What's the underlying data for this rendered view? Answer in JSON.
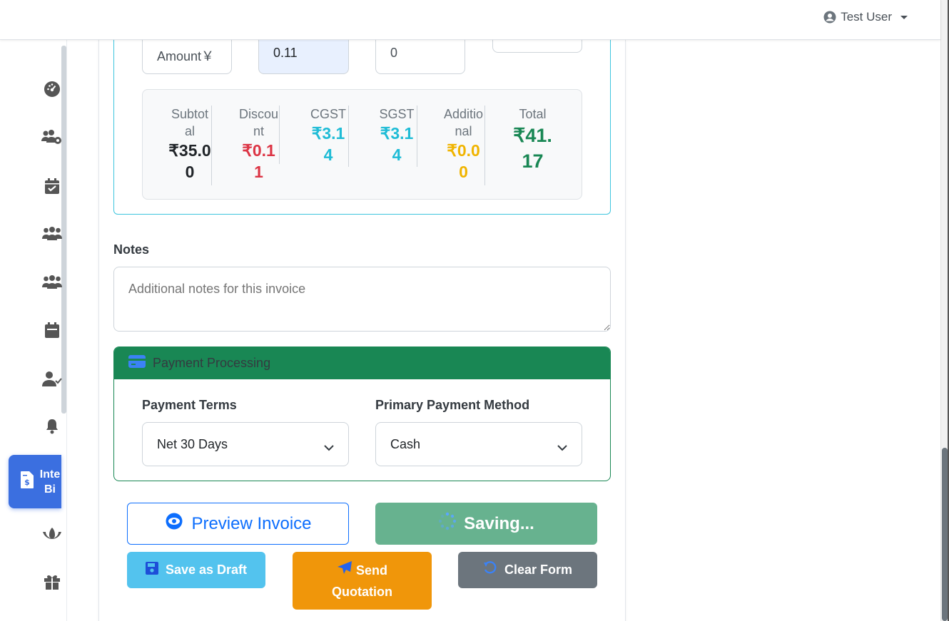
{
  "header": {
    "user_name": "Test User"
  },
  "sidebar": {
    "items": [
      {
        "icon": "dashboard-icon"
      },
      {
        "icon": "users-cog-icon"
      },
      {
        "icon": "calendar-check-icon"
      },
      {
        "icon": "users-icon"
      },
      {
        "icon": "users-group-icon"
      },
      {
        "icon": "calendar-icon"
      },
      {
        "icon": "user-check-icon"
      },
      {
        "icon": "bell-icon"
      },
      {
        "icon": "invoice-icon",
        "label": "Inte\nBi",
        "active": true
      },
      {
        "icon": "lotus-icon"
      },
      {
        "icon": "gift-icon"
      }
    ]
  },
  "line_item": {
    "amount_placeholder": "Amount",
    "discount_value": "0.11",
    "qty_value": "0"
  },
  "totals": {
    "subtotal_label": "Subtotal",
    "subtotal_value": "₹35.00",
    "discount_label": "Discount",
    "discount_value": "₹0.11",
    "cgst_label": "CGST",
    "cgst_value": "₹3.14",
    "sgst_label": "SGST",
    "sgst_value": "₹3.14",
    "additional_label": "Additional",
    "additional_value": "₹0.00",
    "total_label": "Total",
    "total_value": "₹41.17"
  },
  "notes": {
    "label": "Notes",
    "placeholder": "Additional notes for this invoice"
  },
  "payment": {
    "section_title": "Payment Processing",
    "terms_label": "Payment Terms",
    "terms_value": "Net 30 Days",
    "method_label": "Primary Payment Method",
    "method_value": "Cash"
  },
  "actions": {
    "preview_label": "Preview Invoice",
    "saving_label": "Saving...",
    "draft_label": "Save as Draft",
    "send_label": "Send Quotation",
    "clear_label": "Clear Form"
  },
  "colors": {
    "primary": "#0d6efd",
    "success": "#198754",
    "info": "#0dcaf0",
    "danger": "#dc3545",
    "warning": "#f0ad00",
    "secondary": "#6c757d"
  }
}
